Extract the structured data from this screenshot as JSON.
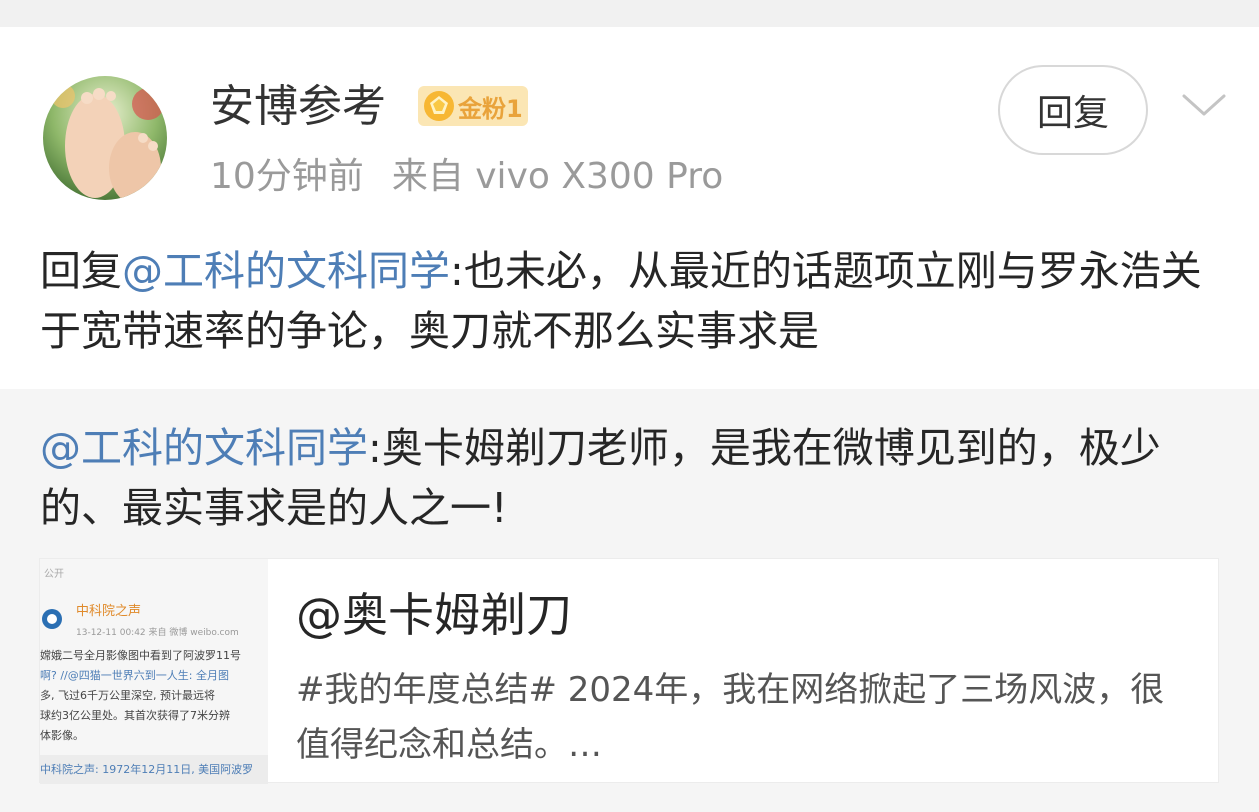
{
  "post": {
    "username": "安博参考",
    "badge_label": "金粉1",
    "time": "10分钟前",
    "source": "来自 vivo X300 Pro",
    "reply_button": "回复",
    "body_prefix": "回复",
    "body_mention": "@工科的文科同学",
    "body_text": ":也未必，从最近的话题项立刚与罗永浩关于宽带速率的争论，奥刀就不那么实事求是"
  },
  "quote": {
    "mention": "@工科的文科同学",
    "text": ":奥卡姆剃刀老师，是我在微博见到的，极少的、最实事求是的人之一!"
  },
  "card": {
    "title": "@奥卡姆剃刀",
    "description": "#我的年度总结# 2024年，我在网络掀起了三场风波，很值得纪念和总结。…",
    "thumb": {
      "visibility": "公开",
      "account": "中科院之声",
      "date": "13-12-11 00:42  来自 微博 weibo.com",
      "lines": [
        "嫦娥二号全月影像图中看到了阿波罗11号",
        "啊? //@四猫一世界六到一人生: 全月图",
        "多, 飞过6千万公里深空, 预计最远将",
        "球约3亿公里处。其首次获得了7米分辨",
        "体影像。",
        "中科院之声: 1972年12月11日, 美国阿波罗"
      ]
    }
  },
  "colors": {
    "mention": "#4e7eb6",
    "badge_bg": "#fbe6b4"
  }
}
